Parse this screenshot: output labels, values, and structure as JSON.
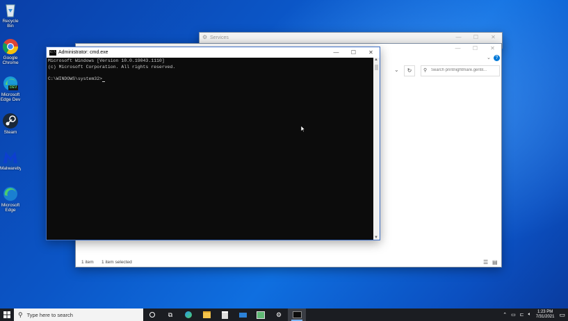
{
  "desktop": {
    "icons": [
      {
        "name": "recycle-bin",
        "label": "Recycle Bin"
      },
      {
        "name": "google-chrome",
        "label": "Google Chrome"
      },
      {
        "name": "edge-dev",
        "label": "Microsoft Edge Dev",
        "badge": "DEV"
      },
      {
        "name": "steam",
        "label": "Steam"
      },
      {
        "name": "malwarebytes",
        "label": "Malwareby..."
      },
      {
        "name": "microsoft-edge",
        "label": "Microsoft Edge"
      }
    ]
  },
  "services_window": {
    "title": "Services"
  },
  "explorer_window": {
    "search_placeholder": "Search printnightmare.gentil...",
    "status_items": "1 item",
    "status_selected": "1 item selected",
    "help_icon": "?"
  },
  "cmd_window": {
    "title": "Administrator: cmd.exe",
    "icon_text": "C:\\",
    "lines": [
      "Microsoft Windows [Version 10.0.19043.1110]",
      "(c) Microsoft Corporation. All rights reserved.",
      "",
      "C:\\WINDOWS\\system32>"
    ]
  },
  "taskbar": {
    "search_placeholder": "Type here to search",
    "clock_time": "1:23 PM",
    "clock_date": "7/31/2021"
  },
  "colors": {
    "taskbar": "#1b1d22",
    "cmd_bg": "#0c0c0c",
    "accent": "#0078d7"
  }
}
